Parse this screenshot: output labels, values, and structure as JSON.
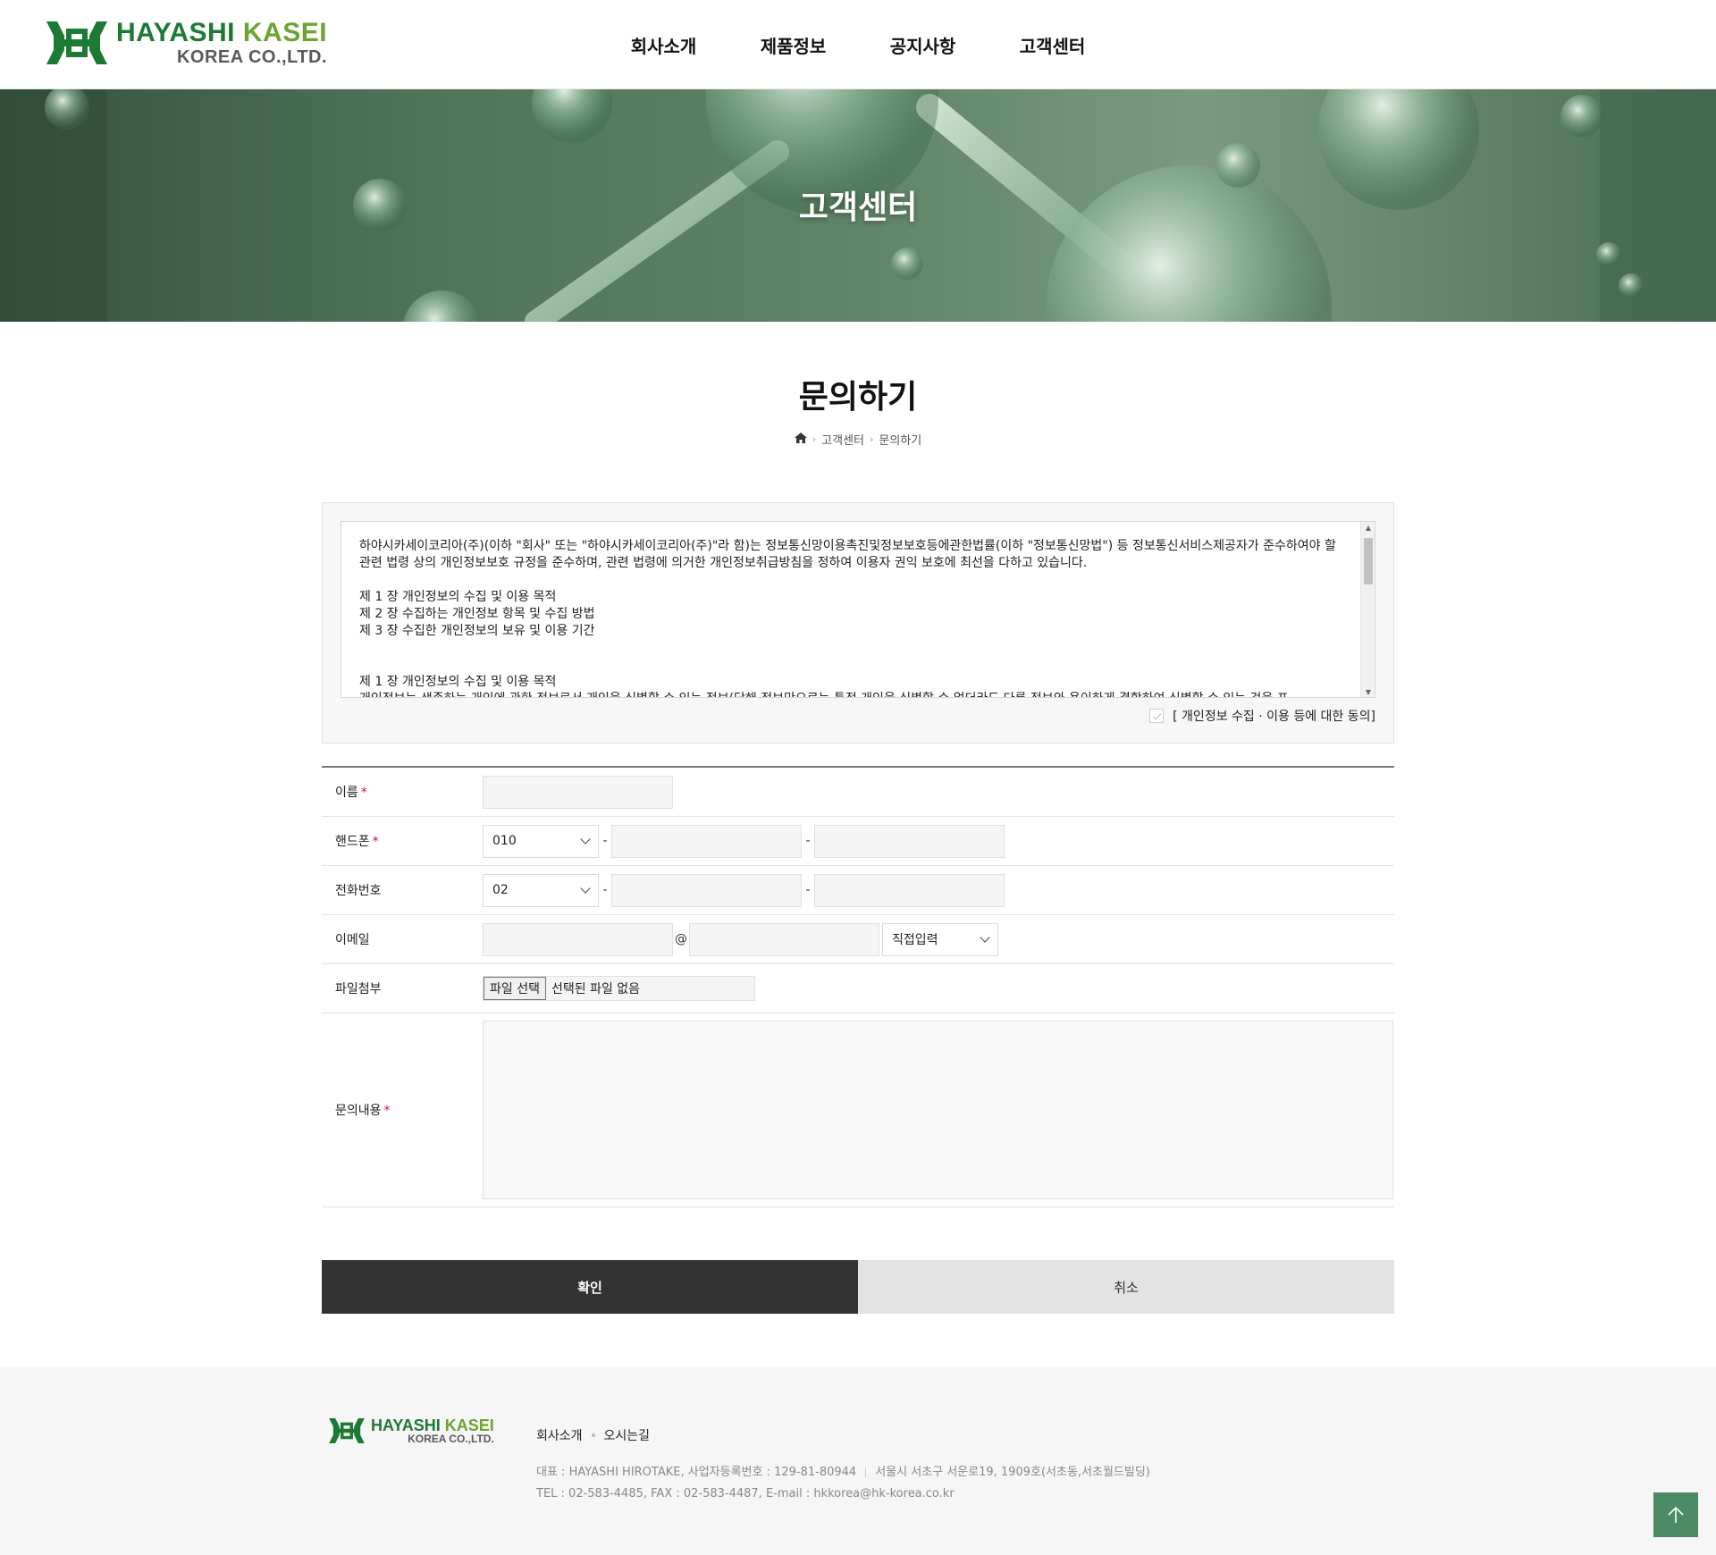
{
  "header": {
    "logo_line1_a": "HAYASHI",
    "logo_line1_b": "KASEI",
    "logo_line2": "KOREA CO.,LTD.",
    "nav": [
      "회사소개",
      "제품정보",
      "공지사항",
      "고객센터"
    ]
  },
  "banner": {
    "title": "고객센터"
  },
  "page": {
    "title": "문의하기",
    "breadcrumb": [
      "고객센터",
      "문의하기"
    ]
  },
  "privacy": {
    "intro": "하야시카세이코리아(주)(이하 \"회사\" 또는 \"하야시카세이코리아(주)\"라 함)는 정보통신망이용촉진및정보보호등에관한법률(이하 \"정보통신망법\") 등 정보통신서비스제공자가 준수하여야 할 관련 법령 상의 개인정보보호 규정을 준수하며, 관련 법령에 의거한 개인정보취급방침을 정하여 이용자 권익 보호에 최선을 다하고 있습니다.",
    "toc": [
      "제 1 장 개인정보의 수집 및 이용 목적",
      "제 2 장 수집하는 개인정보 항목 및 수집 방법",
      "제 3 장 수집한 개인정보의 보유 및 이용 기간"
    ],
    "section1_title": "제 1 장 개인정보의 수집 및 이용 목적",
    "section1_body": "개인정보는 생존하는 개인에 관한 정보로서 개인을 식별할 수 있는 정보(당해 정보만으로는 특정 개인을 식별할 수 없더라도 다른 정보와 용이하게 결합하여 식별할 수 있는 것을 포",
    "agree_label": "[ 개인정보 수집 · 이용 등에 대한 동의]"
  },
  "form": {
    "name_label": "이름",
    "mobile_label": "핸드폰",
    "mobile_prefix": "010",
    "phone_label": "전화번호",
    "phone_prefix": "02",
    "email_label": "이메일",
    "email_at": "@",
    "email_domain_select": "직접입력",
    "file_label": "파일첨부",
    "file_button": "파일 선택",
    "file_status": "선택된 파일 없음",
    "content_label": "문의내용",
    "required_mark": "*",
    "dash": "-"
  },
  "buttons": {
    "confirm": "확인",
    "cancel": "취소"
  },
  "footer": {
    "links": [
      "회사소개",
      "오시는길"
    ],
    "info_line1_a": "대표 : HAYASHI HIROTAKE, 사업자등록번호 : 129-81-80944",
    "info_line1_b": "서울시 서초구 서운로19, 1909호(서초동,서초월드빌딩)",
    "info_line2": "TEL : 02-583-4485, FAX : 02-583-4487, E-mail : hkkorea@hk-korea.co.kr"
  },
  "colors": {
    "brand_green": "#1d7a34",
    "brand_lime": "#6aa532",
    "top_button": "#4c8a63",
    "required": "#d0112b"
  },
  "icons": [
    "logo-mark",
    "home-icon",
    "chevron-right-icon",
    "chevron-down-icon",
    "check-icon",
    "arrow-up-icon"
  ]
}
